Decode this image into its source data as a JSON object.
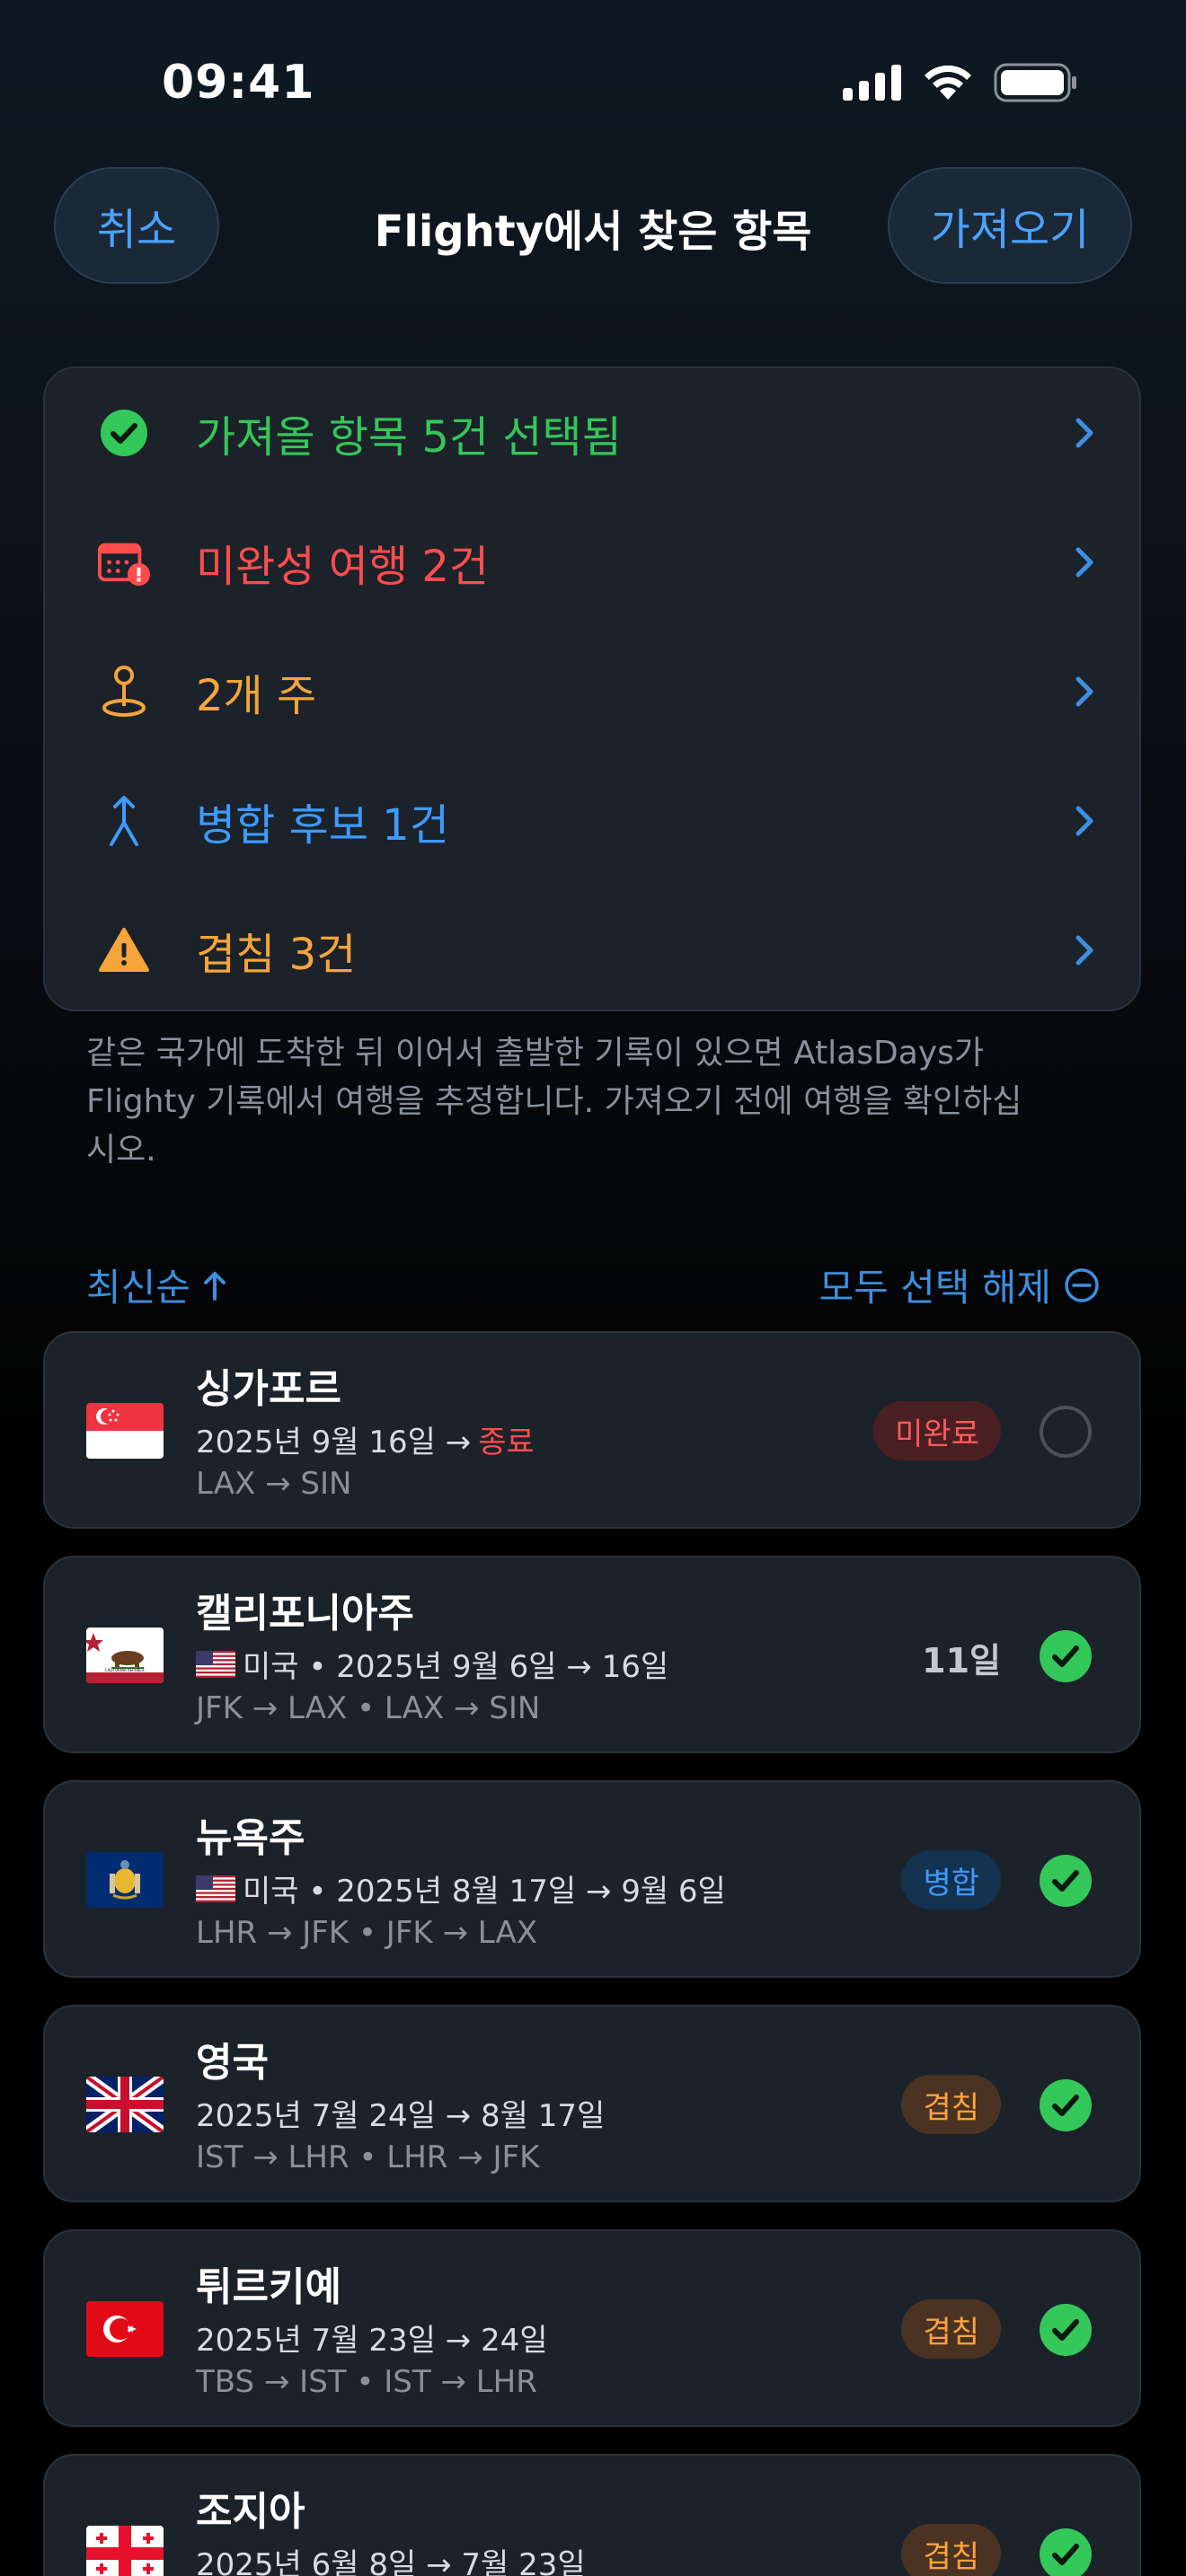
{
  "status": {
    "time": "09:41"
  },
  "nav": {
    "cancel": "취소",
    "title": "Flighty에서 찾은 항목",
    "import": "가져오기"
  },
  "summary": [
    {
      "label": "가져올 항목 5건 선택됨",
      "color": "#34c759",
      "icon": "checkmark-circle-icon"
    },
    {
      "label": "미완성 여행 2건",
      "color": "#ff4d4d",
      "icon": "calendar-alert-icon"
    },
    {
      "label": "2개 주",
      "color": "#f5a53a",
      "icon": "map-pin-icon"
    },
    {
      "label": "병합 후보 1건",
      "color": "#3d9bff",
      "icon": "merge-arrow-icon"
    },
    {
      "label": "겹침 3건",
      "color": "#f5a53a",
      "icon": "warning-triangle-icon"
    }
  ],
  "note": "같은 국가에 도착한 뒤 이어서 출발한 기록이 있으면 AtlasDays가 Flighty 기록에서 여행을 추정합니다. 가져오기 전에 여행을 확인하십시오.",
  "sort": {
    "label": "최신순"
  },
  "deselect_all": "모두 선택 해제",
  "trips": [
    {
      "name": "싱가포르",
      "country": "",
      "dates": "2025년 9월 16일 →",
      "end": "종료",
      "route": "LAX → SIN",
      "badge": "미완료",
      "badge_kind": "red",
      "selected": false,
      "flag": "sg"
    },
    {
      "name": "캘리포니아주",
      "country": "미국 • 2025년 9월 6일 → 16일",
      "dates": "",
      "end": "",
      "route": "JFK → LAX • LAX → SIN",
      "days": "11일",
      "selected": true,
      "flag": "ca"
    },
    {
      "name": "뉴욕주",
      "country": "미국 • 2025년 8월 17일 → 9월 6일",
      "dates": "",
      "end": "",
      "route": "LHR → JFK • JFK → LAX",
      "badge": "병합",
      "badge_kind": "blue",
      "selected": true,
      "flag": "ny"
    },
    {
      "name": "영국",
      "country": "",
      "dates": "2025년 7월 24일 → 8월 17일",
      "end": "",
      "route": "IST → LHR • LHR → JFK",
      "badge": "겹침",
      "badge_kind": "orange",
      "selected": true,
      "flag": "uk"
    },
    {
      "name": "튀르키예",
      "country": "",
      "dates": "2025년 7월 23일 → 24일",
      "end": "",
      "route": "TBS → IST • IST → LHR",
      "badge": "겹침",
      "badge_kind": "orange",
      "selected": true,
      "flag": "tr"
    },
    {
      "name": "조지아",
      "country": "",
      "dates": "2025년 6월 8일 → 7월 23일",
      "end": "",
      "route": "",
      "badge": "겹침",
      "badge_kind": "orange",
      "selected": true,
      "flag": "ge"
    }
  ]
}
